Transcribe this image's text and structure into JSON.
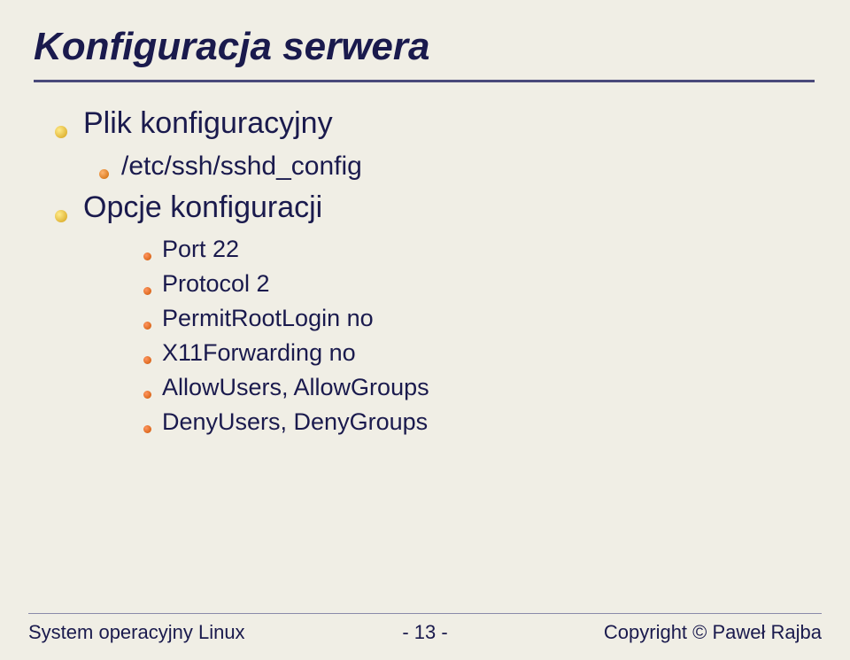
{
  "title": "Konfiguracja serwera",
  "bullets": {
    "item1": "Plik konfiguracyjny",
    "item1_1": "/etc/ssh/sshd_config",
    "item2": "Opcje konfiguracji",
    "item2_1": "Port 22",
    "item2_2": "Protocol 2",
    "item2_3": "PermitRootLogin no",
    "item2_4": "X11Forwarding no",
    "item2_5": "AllowUsers, AllowGroups",
    "item2_6": "DenyUsers, DenyGroups"
  },
  "footer": {
    "left": "System operacyjny Linux",
    "center": "- 13 -",
    "right": "Copyright © Paweł Rajba"
  }
}
